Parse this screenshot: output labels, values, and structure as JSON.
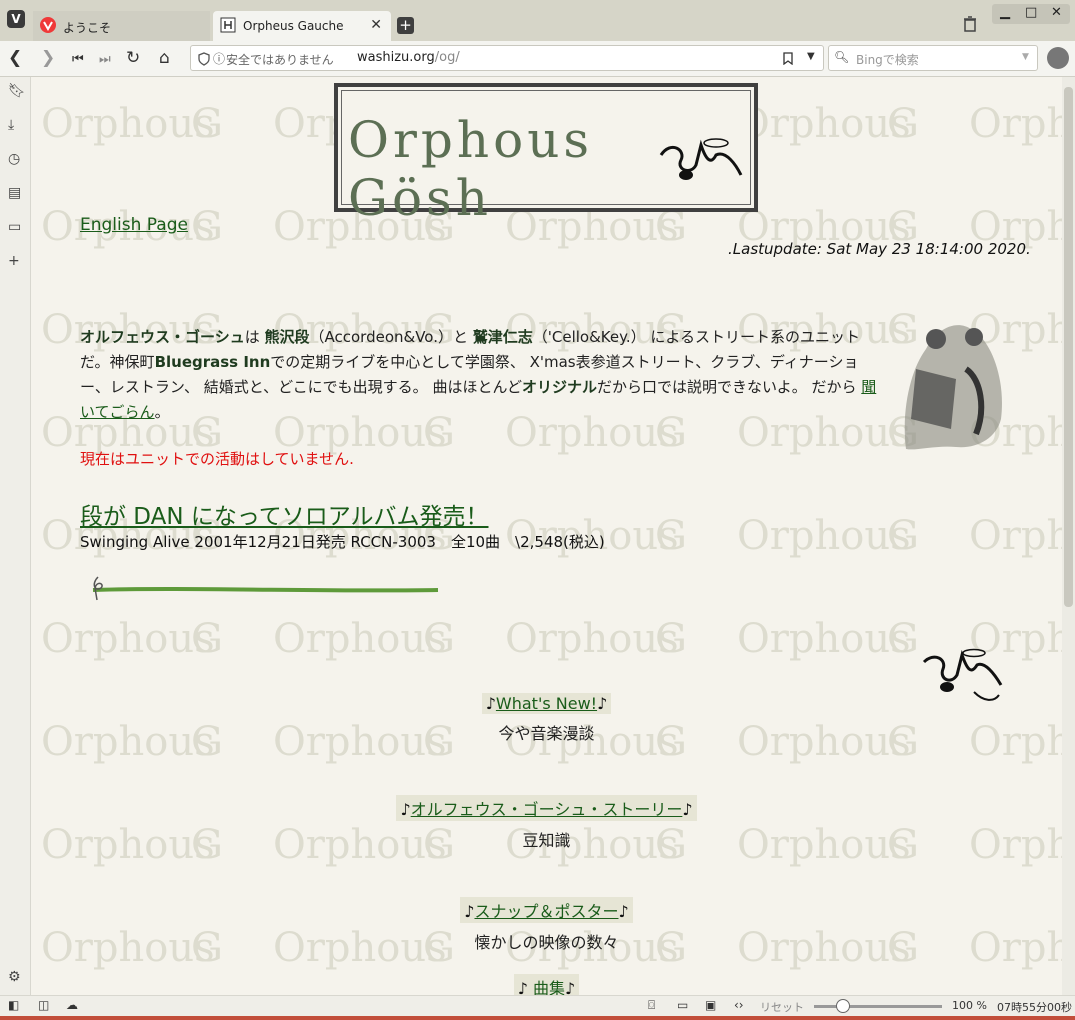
{
  "browser": {
    "tabs": [
      {
        "label": "ようこそ"
      },
      {
        "label": "Orpheus Gauche"
      }
    ],
    "url_security": "安全ではありません",
    "url_host": "washizu.org",
    "url_path": "/og/",
    "search_placeholder": "Bingで検索",
    "status": {
      "reset": "リセット",
      "zoom": "100 %",
      "clock": "07時55分00秒",
      "zoom_level": 0.19
    }
  },
  "page": {
    "logo_text": "Orphous Gösh",
    "english_link": "English Page",
    "lastupdate": ".Lastupdate: Sat May 23 18:14:00 2020.",
    "intro": {
      "name_unit": "オルフェウス・ゴーシュ",
      "t1": "は ",
      "name_kumazawa": "熊沢段",
      "t2": "（Accordeon&Vo.）と ",
      "name_washizu": "鷲津仁志",
      "t3": "（'Cello&Key.） によるストリート系のユニットだ。神保町",
      "venue": "Bluegrass Inn",
      "t4": "での定期ライブを中心として学園祭、 X'mas表参道ストリート、クラブ、ディナーショー、レストラン、 結婚式と、どこにでも出現する。 曲はほとんど",
      "original": "オリジナル",
      "t5": "だから口では説明できないよ。 だから ",
      "listen_link": "聞いてごらん",
      "t6": "。"
    },
    "notice": "現在はユニットでの活動はしていません.",
    "dan_link": "段が DAN になってソロアルバム発売！",
    "album_line": "Swinging Alive 2001年12月21日発売 RCCN-3003　全10曲　\\2,548(税込)",
    "note_symbol": "♪",
    "menu": [
      {
        "link": "What's New!",
        "desc": "今や音楽漫談"
      },
      {
        "link": "オルフェウス・ゴーシュ・ストーリー",
        "desc": "豆知識"
      },
      {
        "link": "スナップ＆ポスター",
        "desc": "懐かしの映像の数々"
      },
      {
        "link": "曲集",
        "desc": ""
      }
    ]
  }
}
